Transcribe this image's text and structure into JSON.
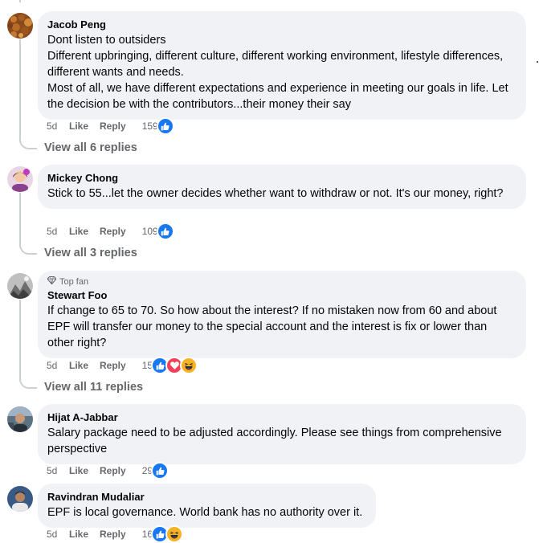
{
  "comments": [
    {
      "author": "Jacob Peng",
      "badge": "",
      "text": "Dont listen to outsiders\nDifferent upbringing, different culture, different working environment, lifestyle differences, different wants and needs.\nMost of all, we have different expectations and experience in meeting our goals in life. Let the decision be with the contributors...their money their say",
      "time": "5d",
      "like_label": "Like",
      "reply_label": "Reply",
      "reaction_count": "159",
      "reactions": [
        "like-icon"
      ],
      "view_replies": "View all 6 replies"
    },
    {
      "author": "Mickey Chong",
      "badge": "",
      "text": "Stick to 55...let the owner decides whether want to withdraw or not. It's our money, right?",
      "time": "5d",
      "like_label": "Like",
      "reply_label": "Reply",
      "reaction_count": "109",
      "reactions": [
        "like-icon"
      ],
      "view_replies": "View all 3 replies"
    },
    {
      "author": "Stewart Foo",
      "badge": "Top fan",
      "text": "If change to 65 to 70. So how about the interest? If no mistaken now from 60 and about EPF will transfer our money to the special account and the interest is fix or lower than other right?",
      "time": "5d",
      "like_label": "Like",
      "reply_label": "Reply",
      "reaction_count": "15",
      "reactions": [
        "like-icon",
        "love-icon",
        "haha-icon"
      ],
      "view_replies": "View all 11 replies"
    },
    {
      "author": "Hijat A-Jabbar",
      "badge": "",
      "text": "Salary package need to be adjusted accordingly. Please see things from comprehensive perspective",
      "time": "5d",
      "like_label": "Like",
      "reply_label": "Reply",
      "reaction_count": "29",
      "reactions": [
        "like-icon"
      ],
      "view_replies": ""
    },
    {
      "author": "Ravindran Mudaliar",
      "badge": "",
      "text": "EPF is local governance. World bank has no authority over it.",
      "time": "5d",
      "like_label": "Like",
      "reply_label": "Reply",
      "reaction_count": "16",
      "reactions": [
        "like-icon",
        "haha-icon"
      ],
      "view_replies": ""
    }
  ],
  "colors": {
    "bubble": "#f0f2f5",
    "muted_text": "#65676b",
    "like_blue": "#1877f2",
    "love_red": "#f33e58",
    "haha_yellow": "#f7b125"
  }
}
